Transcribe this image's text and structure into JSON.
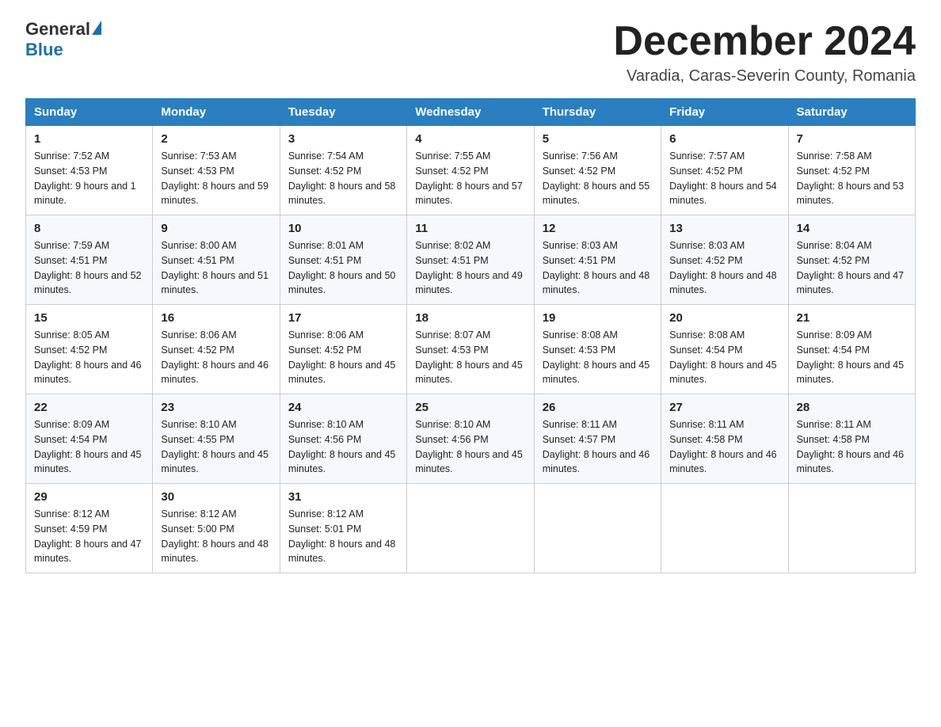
{
  "header": {
    "logo_general": "General",
    "logo_blue": "Blue",
    "month_title": "December 2024",
    "location": "Varadia, Caras-Severin County, Romania"
  },
  "days_of_week": [
    "Sunday",
    "Monday",
    "Tuesday",
    "Wednesday",
    "Thursday",
    "Friday",
    "Saturday"
  ],
  "weeks": [
    [
      {
        "day": "1",
        "sunrise": "7:52 AM",
        "sunset": "4:53 PM",
        "daylight": "9 hours and 1 minute."
      },
      {
        "day": "2",
        "sunrise": "7:53 AM",
        "sunset": "4:53 PM",
        "daylight": "8 hours and 59 minutes."
      },
      {
        "day": "3",
        "sunrise": "7:54 AM",
        "sunset": "4:52 PM",
        "daylight": "8 hours and 58 minutes."
      },
      {
        "day": "4",
        "sunrise": "7:55 AM",
        "sunset": "4:52 PM",
        "daylight": "8 hours and 57 minutes."
      },
      {
        "day": "5",
        "sunrise": "7:56 AM",
        "sunset": "4:52 PM",
        "daylight": "8 hours and 55 minutes."
      },
      {
        "day": "6",
        "sunrise": "7:57 AM",
        "sunset": "4:52 PM",
        "daylight": "8 hours and 54 minutes."
      },
      {
        "day": "7",
        "sunrise": "7:58 AM",
        "sunset": "4:52 PM",
        "daylight": "8 hours and 53 minutes."
      }
    ],
    [
      {
        "day": "8",
        "sunrise": "7:59 AM",
        "sunset": "4:51 PM",
        "daylight": "8 hours and 52 minutes."
      },
      {
        "day": "9",
        "sunrise": "8:00 AM",
        "sunset": "4:51 PM",
        "daylight": "8 hours and 51 minutes."
      },
      {
        "day": "10",
        "sunrise": "8:01 AM",
        "sunset": "4:51 PM",
        "daylight": "8 hours and 50 minutes."
      },
      {
        "day": "11",
        "sunrise": "8:02 AM",
        "sunset": "4:51 PM",
        "daylight": "8 hours and 49 minutes."
      },
      {
        "day": "12",
        "sunrise": "8:03 AM",
        "sunset": "4:51 PM",
        "daylight": "8 hours and 48 minutes."
      },
      {
        "day": "13",
        "sunrise": "8:03 AM",
        "sunset": "4:52 PM",
        "daylight": "8 hours and 48 minutes."
      },
      {
        "day": "14",
        "sunrise": "8:04 AM",
        "sunset": "4:52 PM",
        "daylight": "8 hours and 47 minutes."
      }
    ],
    [
      {
        "day": "15",
        "sunrise": "8:05 AM",
        "sunset": "4:52 PM",
        "daylight": "8 hours and 46 minutes."
      },
      {
        "day": "16",
        "sunrise": "8:06 AM",
        "sunset": "4:52 PM",
        "daylight": "8 hours and 46 minutes."
      },
      {
        "day": "17",
        "sunrise": "8:06 AM",
        "sunset": "4:52 PM",
        "daylight": "8 hours and 45 minutes."
      },
      {
        "day": "18",
        "sunrise": "8:07 AM",
        "sunset": "4:53 PM",
        "daylight": "8 hours and 45 minutes."
      },
      {
        "day": "19",
        "sunrise": "8:08 AM",
        "sunset": "4:53 PM",
        "daylight": "8 hours and 45 minutes."
      },
      {
        "day": "20",
        "sunrise": "8:08 AM",
        "sunset": "4:54 PM",
        "daylight": "8 hours and 45 minutes."
      },
      {
        "day": "21",
        "sunrise": "8:09 AM",
        "sunset": "4:54 PM",
        "daylight": "8 hours and 45 minutes."
      }
    ],
    [
      {
        "day": "22",
        "sunrise": "8:09 AM",
        "sunset": "4:54 PM",
        "daylight": "8 hours and 45 minutes."
      },
      {
        "day": "23",
        "sunrise": "8:10 AM",
        "sunset": "4:55 PM",
        "daylight": "8 hours and 45 minutes."
      },
      {
        "day": "24",
        "sunrise": "8:10 AM",
        "sunset": "4:56 PM",
        "daylight": "8 hours and 45 minutes."
      },
      {
        "day": "25",
        "sunrise": "8:10 AM",
        "sunset": "4:56 PM",
        "daylight": "8 hours and 45 minutes."
      },
      {
        "day": "26",
        "sunrise": "8:11 AM",
        "sunset": "4:57 PM",
        "daylight": "8 hours and 46 minutes."
      },
      {
        "day": "27",
        "sunrise": "8:11 AM",
        "sunset": "4:58 PM",
        "daylight": "8 hours and 46 minutes."
      },
      {
        "day": "28",
        "sunrise": "8:11 AM",
        "sunset": "4:58 PM",
        "daylight": "8 hours and 46 minutes."
      }
    ],
    [
      {
        "day": "29",
        "sunrise": "8:12 AM",
        "sunset": "4:59 PM",
        "daylight": "8 hours and 47 minutes."
      },
      {
        "day": "30",
        "sunrise": "8:12 AM",
        "sunset": "5:00 PM",
        "daylight": "8 hours and 48 minutes."
      },
      {
        "day": "31",
        "sunrise": "8:12 AM",
        "sunset": "5:01 PM",
        "daylight": "8 hours and 48 minutes."
      },
      null,
      null,
      null,
      null
    ]
  ]
}
